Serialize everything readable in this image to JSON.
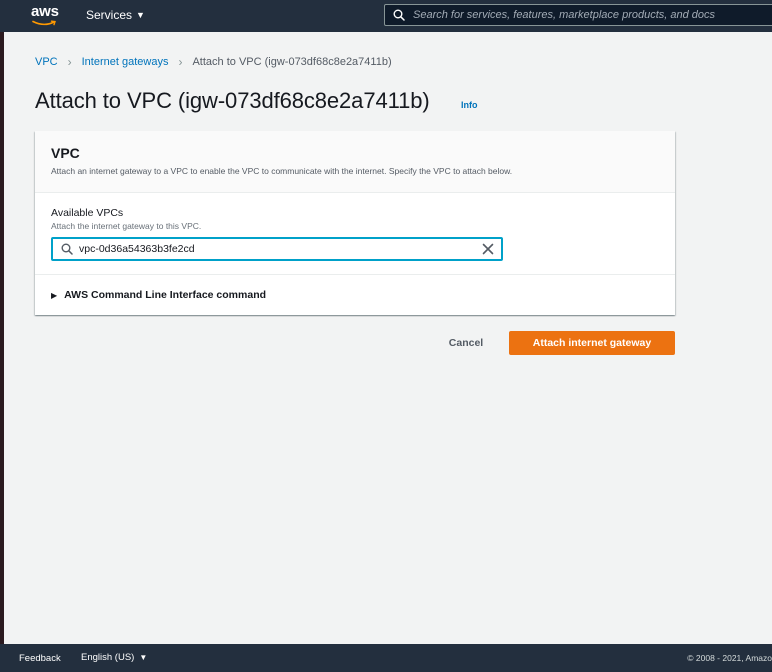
{
  "topnav": {
    "logo_text": "aws",
    "services_label": "Services",
    "search_placeholder": "Search for services, features, marketplace products, and docs"
  },
  "breadcrumb": {
    "items": [
      "VPC",
      "Internet gateways"
    ],
    "current": "Attach to VPC (igw-073df68c8e2a7411b)"
  },
  "page": {
    "title": "Attach to VPC (igw-073df68c8e2a7411b)",
    "info_label": "Info"
  },
  "panel": {
    "title": "VPC",
    "description": "Attach an internet gateway to a VPC to enable the VPC to communicate with the internet. Specify the VPC to attach below.",
    "field_label": "Available VPCs",
    "field_description": "Attach the internet gateway to this VPC.",
    "field_value": "vpc-0d36a54363b3fe2cd",
    "cli_label": "AWS Command Line Interface command"
  },
  "actions": {
    "cancel_label": "Cancel",
    "attach_label": "Attach internet gateway"
  },
  "footer": {
    "feedback_label": "Feedback",
    "language_label": "English (US)",
    "copyright": "© 2008 - 2021, Amazo"
  },
  "colors": {
    "nav_bg": "#232f3e",
    "link": "#0073bb",
    "primary_button": "#ec7211",
    "focus_border": "#00a1c9"
  }
}
